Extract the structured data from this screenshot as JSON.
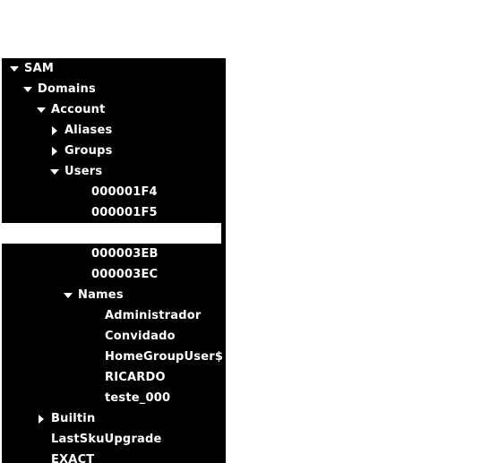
{
  "window": {
    "background_color": "#ffffff",
    "panel_background_color": "#000000",
    "text_color": "#ffffff",
    "selection_color": "#ffffff"
  },
  "tree": {
    "name": "registry-tree",
    "rows": [
      {
        "label": "SAM",
        "indent": 0,
        "twisty": "expanded",
        "selected": false
      },
      {
        "label": "Domains",
        "indent": 1,
        "twisty": "expanded",
        "selected": false
      },
      {
        "label": "Account",
        "indent": 2,
        "twisty": "expanded",
        "selected": false
      },
      {
        "label": "Aliases",
        "indent": 3,
        "twisty": "collapsed",
        "selected": false
      },
      {
        "label": "Groups",
        "indent": 3,
        "twisty": "collapsed",
        "selected": false
      },
      {
        "label": "Users",
        "indent": 3,
        "twisty": "expanded",
        "selected": false
      },
      {
        "label": "000001F4",
        "indent": 5,
        "twisty": "none",
        "selected": false
      },
      {
        "label": "000001F5",
        "indent": 5,
        "twisty": "none",
        "selected": false
      },
      {
        "label": "",
        "indent": 5,
        "twisty": "none",
        "selected": true
      },
      {
        "label": "000003EB",
        "indent": 5,
        "twisty": "none",
        "selected": false
      },
      {
        "label": "000003EC",
        "indent": 5,
        "twisty": "none",
        "selected": false
      },
      {
        "label": "Names",
        "indent": 4,
        "twisty": "expanded",
        "selected": false
      },
      {
        "label": "Administrador",
        "indent": 6,
        "twisty": "none",
        "selected": false
      },
      {
        "label": "Convidado",
        "indent": 6,
        "twisty": "none",
        "selected": false
      },
      {
        "label": "HomeGroupUser$",
        "indent": 6,
        "twisty": "none",
        "selected": false
      },
      {
        "label": "RICARDO",
        "indent": 6,
        "twisty": "none",
        "selected": false
      },
      {
        "label": "teste_000",
        "indent": 6,
        "twisty": "none",
        "selected": false
      },
      {
        "label": "Builtin",
        "indent": 2,
        "twisty": "collapsed",
        "selected": false
      },
      {
        "label": "LastSkuUpgrade",
        "indent": 2,
        "twisty": "none",
        "selected": false
      },
      {
        "label": "EXACT",
        "indent": 2,
        "twisty": "none",
        "selected": false
      }
    ]
  }
}
